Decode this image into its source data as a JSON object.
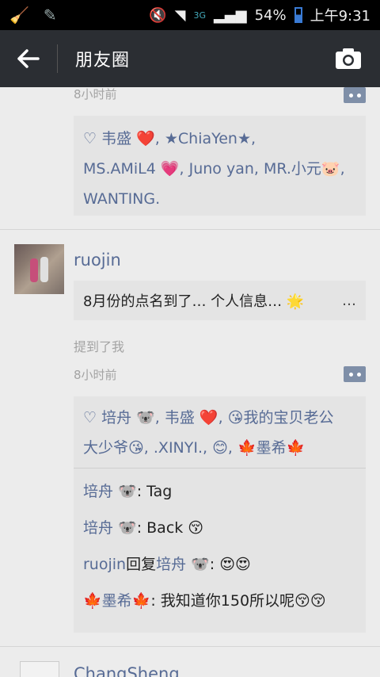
{
  "status_bar": {
    "network": "3G",
    "battery": "54%",
    "clock": "上午9:31"
  },
  "app_bar": {
    "title": "朋友圈"
  },
  "post1": {
    "time": "8小时前",
    "likes_line1": "韦盛 ❤️, ★ChiaYen★,",
    "likes_line2": "MS.AMiL4 💗, Juno yan, MR.小元🐷,",
    "likes_line3": "WANTING."
  },
  "post2": {
    "author": "ruojin",
    "link_text": "8月份的点名到了… 个人信息… 🌟",
    "link_more": "…",
    "mention": "提到了我",
    "time": "8小时前",
    "likes_line1": "培舟 🐨, 韦盛 ❤️, 😘我的宝贝老公",
    "likes_line2": "大少爷😘, .XINYI., 😊, 🍁墨希🍁",
    "comments": [
      {
        "who": "培舟 🐨",
        "text": ": Tag"
      },
      {
        "who": "培舟 🐨",
        "text": ": Back 😚"
      },
      {
        "who": "ruojin",
        "mid": "回复",
        "who2": "培舟 🐨",
        "text": ": 😍😍"
      },
      {
        "who": "🍁墨希🍁",
        "text": ": 我知道你150所以呢😚😚"
      }
    ]
  },
  "post3": {
    "author": "ChangSheng"
  }
}
